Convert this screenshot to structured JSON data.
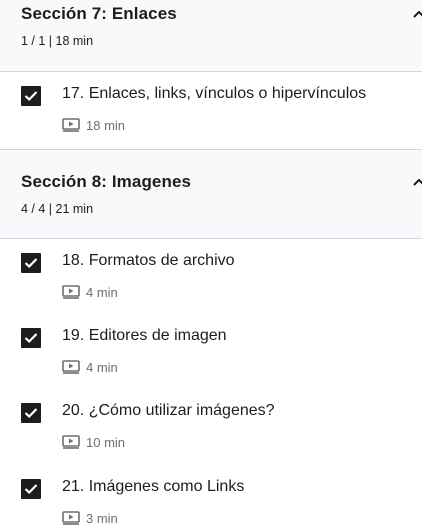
{
  "sections": [
    {
      "title": "Sección 7: Enlaces",
      "meta": "1 / 1 | 18 min",
      "lessons": [
        {
          "title": "17. Enlaces, links, vínculos o hipervínculos",
          "duration": "18 min",
          "completed": true
        }
      ]
    },
    {
      "title": "Sección 8: Imagenes",
      "meta": "4 / 4 | 21 min",
      "lessons": [
        {
          "title": "18. Formatos de archivo",
          "duration": "4 min",
          "completed": true
        },
        {
          "title": "19. Editores de imagen",
          "duration": "4 min",
          "completed": true
        },
        {
          "title": "20. ¿Cómo utilizar imágenes?",
          "duration": "10 min",
          "completed": true
        },
        {
          "title": "21. Imágenes como Links",
          "duration": "3 min",
          "completed": true
        }
      ]
    }
  ],
  "icons": {
    "checkbox": "checkbox-checked-icon",
    "video": "video-play-icon",
    "collapse": "chevron-up-icon"
  },
  "colors": {
    "text": "#1c1d1f",
    "muted": "#6a6f73",
    "section_bg": "#f7f9fa",
    "checkbox_bg": "#1c1d1f"
  }
}
